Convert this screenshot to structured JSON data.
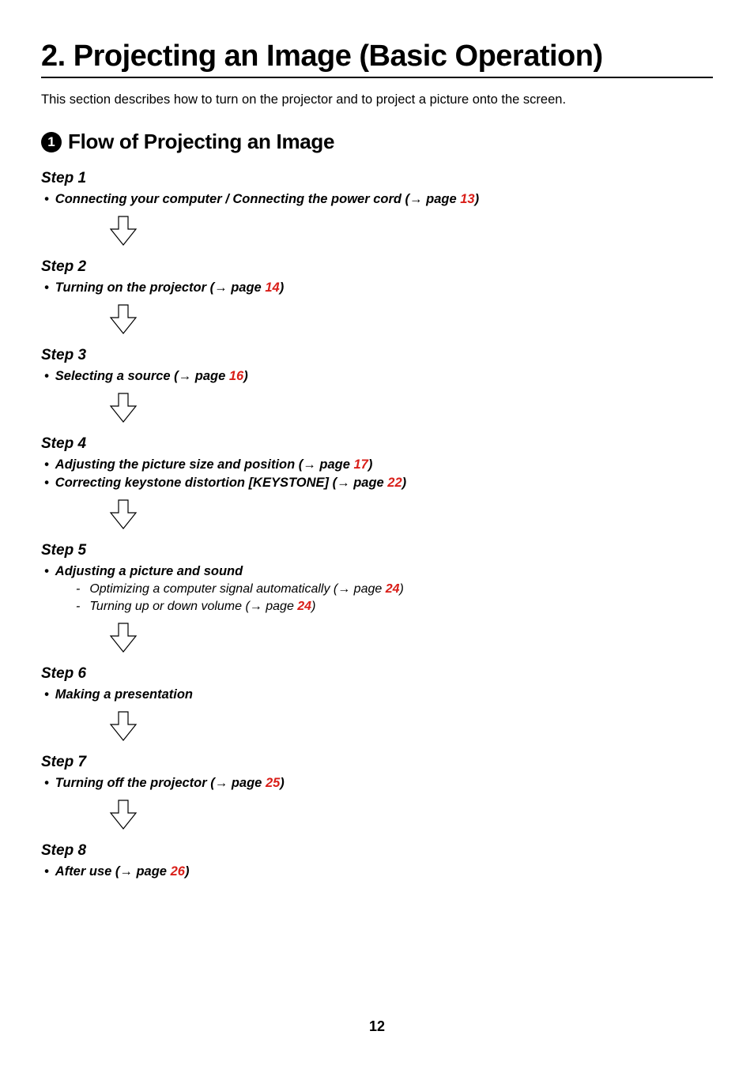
{
  "chapter": {
    "title": "2. Projecting an Image (Basic Operation)",
    "intro": "This section describes how to turn on the projector and to project a picture onto the screen."
  },
  "section": {
    "badge": "1",
    "title": "Flow of Projecting an Image"
  },
  "steps": [
    {
      "label": "Step 1",
      "items": [
        {
          "prefix": "Connecting your computer / Connecting the power cord (",
          "arrow": "→",
          "pageWord": " page ",
          "page": "13",
          "suffix": ")"
        }
      ],
      "arrowAfter": true
    },
    {
      "label": "Step 2",
      "items": [
        {
          "prefix": "Turning on the projector (",
          "arrow": "→",
          "pageWord": " page ",
          "page": "14",
          "suffix": ")"
        }
      ],
      "arrowAfter": true
    },
    {
      "label": "Step 3",
      "items": [
        {
          "prefix": "Selecting a source (",
          "arrow": "→",
          "pageWord": " page ",
          "page": "16",
          "suffix": ")"
        }
      ],
      "arrowAfter": true
    },
    {
      "label": "Step 4",
      "items": [
        {
          "prefix": "Adjusting the picture size and position (",
          "arrow": "→",
          "pageWord": " page ",
          "page": "17",
          "suffix": ")"
        },
        {
          "prefix": "Correcting keystone distortion [KEYSTONE] (",
          "arrow": "→",
          "pageWord": " page ",
          "page": "22",
          "suffix": ")"
        }
      ],
      "arrowAfter": true
    },
    {
      "label": "Step 5",
      "items": [
        {
          "prefix": "Adjusting a picture and sound"
        }
      ],
      "subitems": [
        {
          "prefix": "Optimizing a computer signal automatically (",
          "arrow": "→",
          "pageWord": " page ",
          "page": "24",
          "suffix": ")"
        },
        {
          "prefix": "Turning up or down volume (",
          "arrow": "→",
          "pageWord": " page ",
          "page": "24",
          "suffix": ")"
        }
      ],
      "arrowAfter": true
    },
    {
      "label": "Step 6",
      "items": [
        {
          "prefix": "Making a presentation"
        }
      ],
      "arrowAfter": true
    },
    {
      "label": "Step 7",
      "items": [
        {
          "prefix": "Turning off the projector (",
          "arrow": "→",
          "pageWord": " page ",
          "page": "25",
          "suffix": ")"
        }
      ],
      "arrowAfter": true
    },
    {
      "label": "Step 8",
      "items": [
        {
          "prefix": "After use (",
          "arrow": "→",
          "pageWord": " page ",
          "page": "26",
          "suffix": ")"
        }
      ],
      "arrowAfter": false
    }
  ],
  "pageNumber": "12"
}
